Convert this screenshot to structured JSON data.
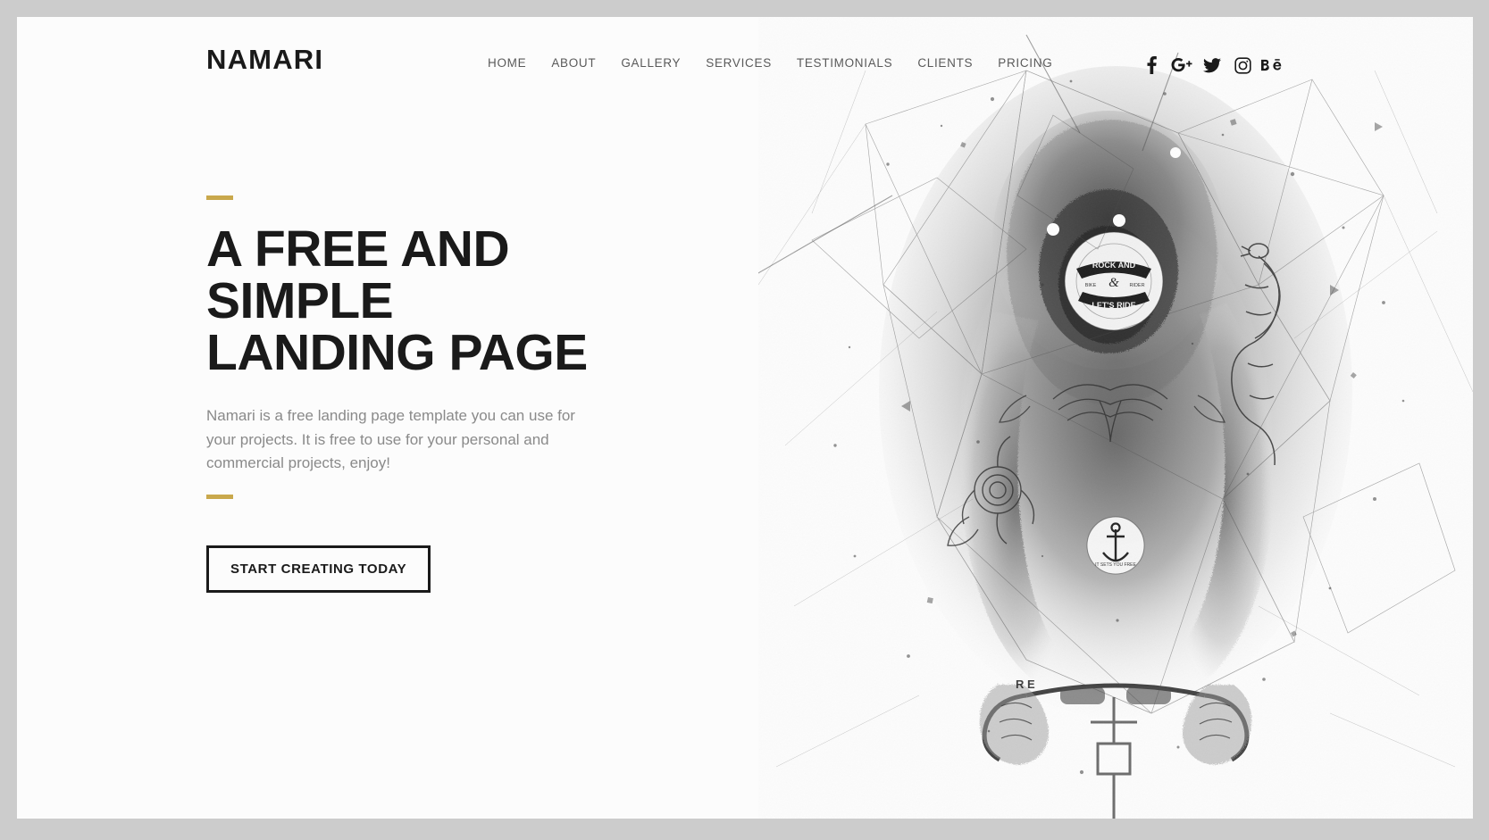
{
  "page": {
    "background_color": "#cccccc",
    "canvas_color": "#fcfcfc",
    "accent_color": "#c9a84c",
    "text_color": "#1a1a1a",
    "muted_text_color": "#8a8a8a"
  },
  "header": {
    "logo": "NAMARI",
    "nav": [
      {
        "label": "HOME"
      },
      {
        "label": "ABOUT"
      },
      {
        "label": "GALLERY"
      },
      {
        "label": "SERVICES"
      },
      {
        "label": "TESTIMONIALS"
      },
      {
        "label": "CLIENTS"
      },
      {
        "label": "PRICING"
      }
    ],
    "social": [
      {
        "name": "facebook-icon",
        "label": "f"
      },
      {
        "name": "google-plus-icon",
        "label": "G+"
      },
      {
        "name": "twitter-icon",
        "label": ""
      },
      {
        "name": "instagram-icon",
        "label": ""
      },
      {
        "name": "behance-icon",
        "label": "Bē"
      }
    ]
  },
  "hero": {
    "title": "A Free and Simple Landing Page",
    "subtitle": "Namari is a free landing page template you can use for your projects. It is free to use for your personal and commercial projects, enjoy!",
    "cta_label": "START CREATING TODAY",
    "artwork_alt": "Monochrome ink sketch illustration of a tattooed cyclist leaning over handlebars"
  }
}
